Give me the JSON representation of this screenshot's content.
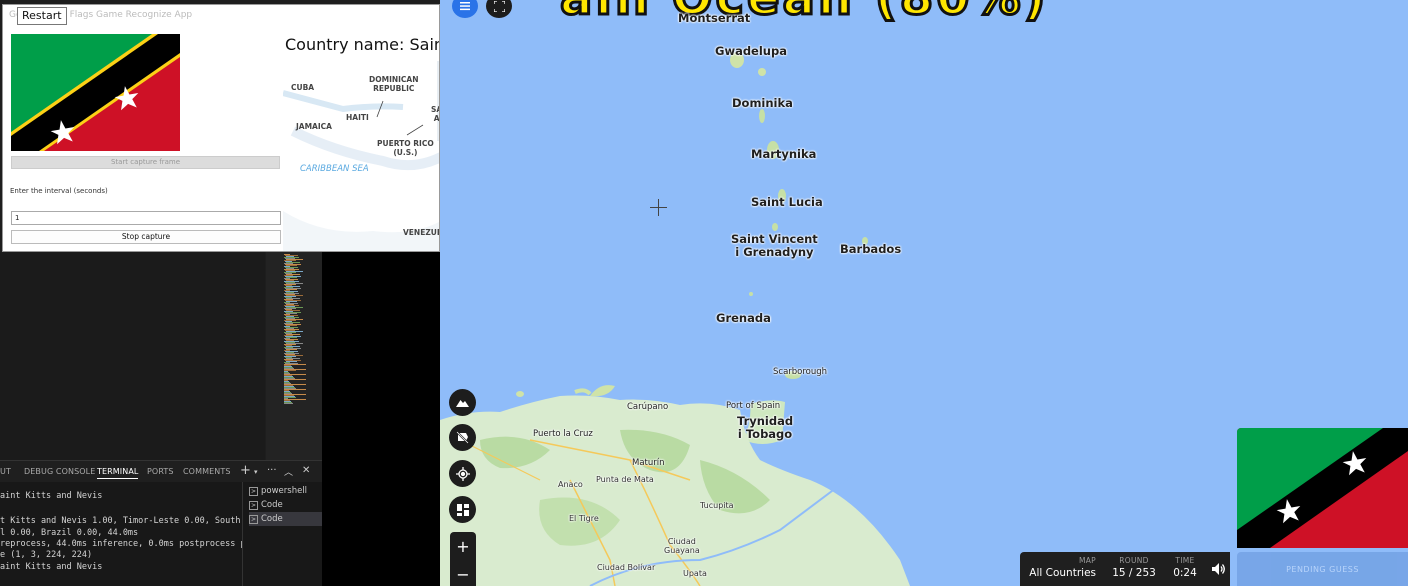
{
  "app": {
    "title": "Geo Guesser Flags Game Recognize App",
    "restart_tooltip": "Restart",
    "capture_frame_button": "Start capture frame",
    "interval_label": "Enter the interval (seconds)",
    "interval_value": "1",
    "stop_button": "Stop capture",
    "country_name": "Country name: Saint",
    "minimap_labels": {
      "cuba": "CUBA",
      "dominican_republic": "DOMINICAN\nREPUBLIC",
      "haiti": "HAITI",
      "jamaica": "JAMAICA",
      "puerto_rico": "PUERTO RICO\n(U.S.)",
      "caribbean_sea": "CARIBBEAN SEA",
      "venezuela": "VENEZUELA",
      "sa": "SA\nA"
    }
  },
  "vscode": {
    "panel_tabs": [
      "UT",
      "DEBUG CONSOLE",
      "TERMINAL",
      "PORTS",
      "COMMENTS"
    ],
    "active_tab": "TERMINAL",
    "terminal_lines": [
      "aint Kitts and Nevis",
      "",
      "t Kitts and Nevis 1.00, Timor-Leste 0.00, South K",
      "l 0.00, Brazil 0.00, 44.0ms",
      "reprocess, 44.0ms inference, 0.0ms postprocess pe",
      "e (1, 3, 224, 224)",
      "aint Kitts and Nevis"
    ],
    "terminal_list": [
      {
        "label": "powershell",
        "selected": false
      },
      {
        "label": "Code",
        "selected": false
      },
      {
        "label": "Code",
        "selected": true
      }
    ]
  },
  "game": {
    "places": {
      "montserrat": "Montserrat",
      "gwadelupa": "Gwadelupa",
      "dominika": "Dominika",
      "martynika": "Martynika",
      "saint_lucia": "Saint Lucia",
      "saint_vincent": "Saint Vincent\ni Grenadyny",
      "barbados": "Barbados",
      "grenada": "Grenada",
      "scarborough": "Scarborough",
      "port_of_spain": "Port of Spain",
      "trynidad": "Trynidad\ni Tobago",
      "carupano": "Carúpano",
      "puerto_la_cruz": "Puerto la Cruz",
      "maturin": "Maturín",
      "anaco": "Anaco",
      "punta_de_mata": "Punta de Mata",
      "tucupita": "Tucupita",
      "el_tigre": "El Tigre",
      "ciudad_guayana": "Ciudad\nGuayana",
      "ciudad_bolivar": "Ciudad Bolívar",
      "upata": "Upata"
    },
    "info": {
      "map_label": "MAP",
      "map_value": "All Countries",
      "round_label": "ROUND",
      "round_value": "15 / 253",
      "time_label": "TIME",
      "time_value": "0:24"
    },
    "zoom_in": "+",
    "zoom_out": "−",
    "guess_button": "PENDING GUESS",
    "overlay_title": "ain Ocean (80%)",
    "icons": [
      "menu-icon",
      "fullscreen-icon",
      "terrain-icon",
      "hide-labels-icon",
      "locate-icon",
      "layers-icon",
      "volume-icon"
    ]
  },
  "colors": {
    "flag_green": "#009e49",
    "flag_red": "#ce1126",
    "flag_yellow": "#fcd116",
    "flag_black": "#000000",
    "sea": "#8fbcf9",
    "land": "#cfe8c8"
  }
}
